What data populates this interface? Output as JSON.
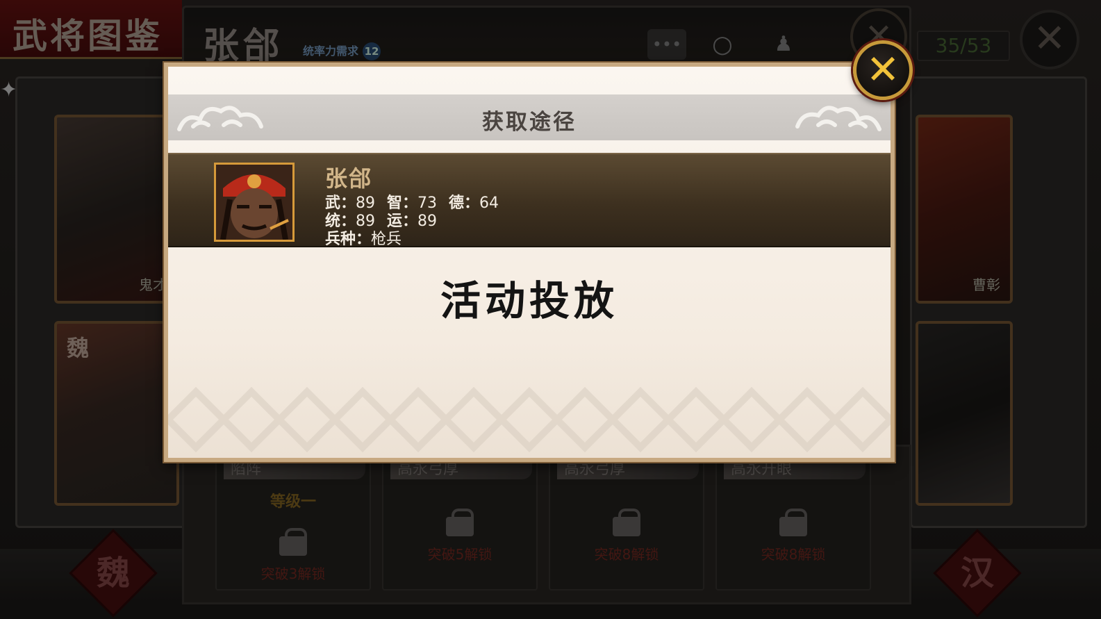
{
  "background": {
    "screen_title": "武将图鉴",
    "general_name": "张郃",
    "cost_label": "统率力需求",
    "cost_value": "12",
    "collection_counter": "35/53",
    "cards": [
      {
        "name": "鬼才",
        "faction": ""
      },
      {
        "name": "",
        "faction": "魏"
      },
      {
        "name": "曹彰",
        "faction": ""
      },
      {
        "name": "",
        "faction": ""
      }
    ],
    "skills": [
      {
        "title": "陷阵",
        "level": "等级一",
        "unlock": "突破3解锁"
      },
      {
        "title": "高永弓厚",
        "level": "",
        "unlock": "突破5解锁"
      },
      {
        "title": "高永弓厚",
        "level": "",
        "unlock": "突破8解锁"
      },
      {
        "title": "高永开眼",
        "level": "",
        "unlock": "突破8解锁"
      }
    ],
    "left_faction_emblem": "魏",
    "right_faction_emblem": "汉",
    "close_glyph": "✕",
    "icons": [
      "chat-icon",
      "search-icon",
      "add-icon"
    ]
  },
  "modal": {
    "title": "获取途径",
    "general": {
      "name": "张郃",
      "stats": {
        "wu_label": "武：",
        "wu": "89",
        "zhi_label": "智：",
        "zhi": "73",
        "de_label": "德：",
        "de": "64",
        "tong_label": "统：",
        "tong": "89",
        "yun_label": "运：",
        "yun": "89",
        "troop_label": "兵种：",
        "troop": "枪兵"
      }
    },
    "acquire_method": "活动投放",
    "close_glyph": "✕"
  },
  "colors": {
    "accent_gold": "#c79a3a",
    "panel_brown": "#3d301f",
    "name_tan": "#d2b68a",
    "lock_red": "#7a2a22"
  }
}
